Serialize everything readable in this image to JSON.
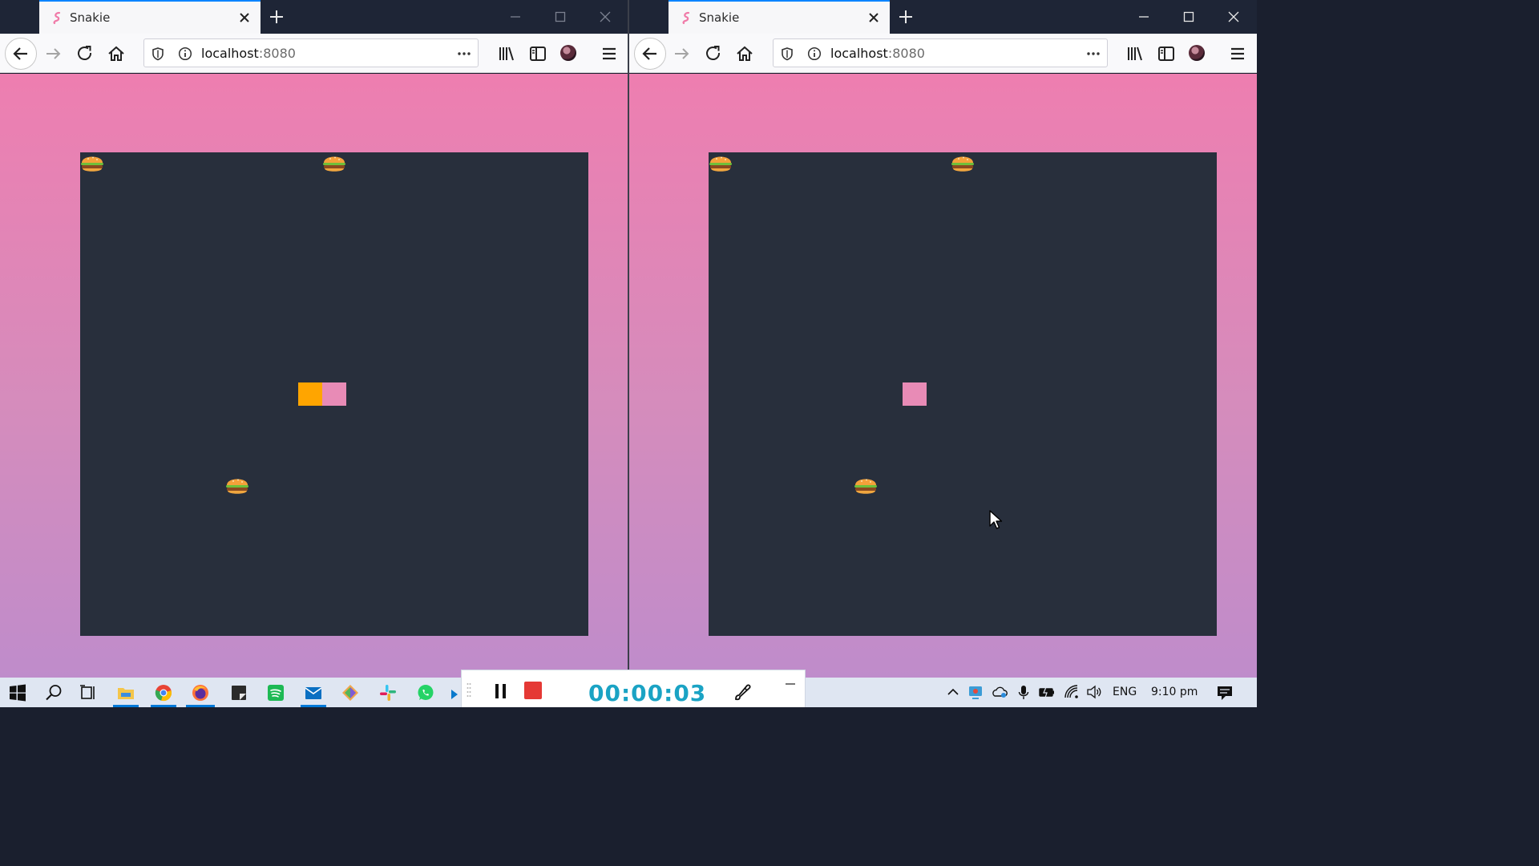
{
  "browser": {
    "tab_title": "Snakie",
    "url_host": "localhost",
    "url_port": ":8080"
  },
  "game": {
    "food_icon": "burger-icon",
    "colors": {
      "background_top": "#ee7eb0",
      "background_bottom": "#bf8ccb",
      "board": "#282f3c",
      "snake_head": "#ffa500",
      "snake_body": "#e88bb6"
    }
  },
  "recorder": {
    "timer": "00:00:03"
  },
  "taskbar": {
    "language": "ENG",
    "clock": "9:10 pm"
  }
}
